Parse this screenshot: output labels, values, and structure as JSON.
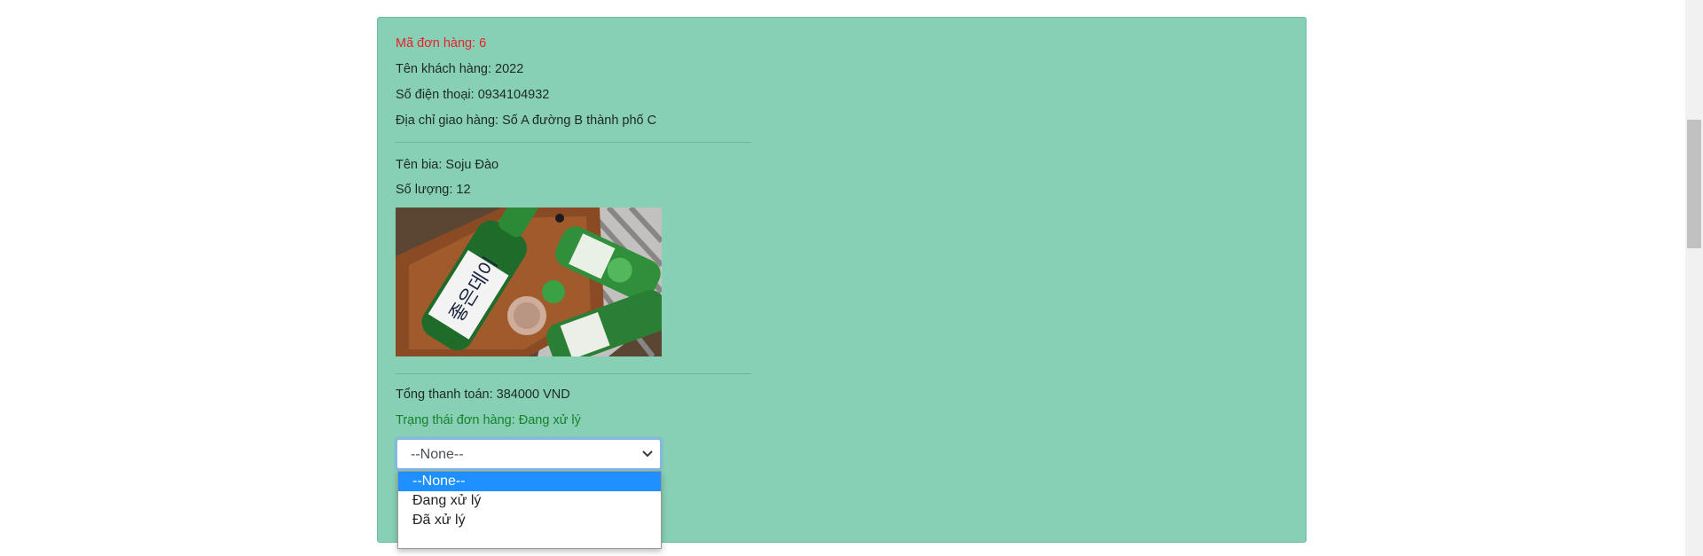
{
  "order": {
    "order_id": "Mã đơn hàng: 6",
    "customer_name": "Tên khách hàng: 2022",
    "phone": "Số điện thoại: 0934104932",
    "address": "Địa chỉ giao hàng: Số A đường B thành phố C",
    "product_name": "Tên bia: Soju Đào",
    "quantity": "Số lượng: 12",
    "total": "Tổng thanh toán: 384000 VND",
    "status": "Trạng thái đơn hàng: Đang xử lý"
  },
  "status_select": {
    "selected_value": "--None--",
    "options": [
      "--None--",
      "Đang xử lý",
      "Đã xử lý"
    ],
    "highlighted_index": 0
  },
  "image": {
    "subject": "soju bottles on wooden tray",
    "bottle_label_text": "좋은데이"
  },
  "colors": {
    "card_background": "#87cfb5",
    "order_id_text": "#e8232b",
    "status_text": "#16822a",
    "dropdown_highlight": "#1e90ff"
  },
  "icons": {
    "select_arrow": "chevron-down-icon"
  }
}
